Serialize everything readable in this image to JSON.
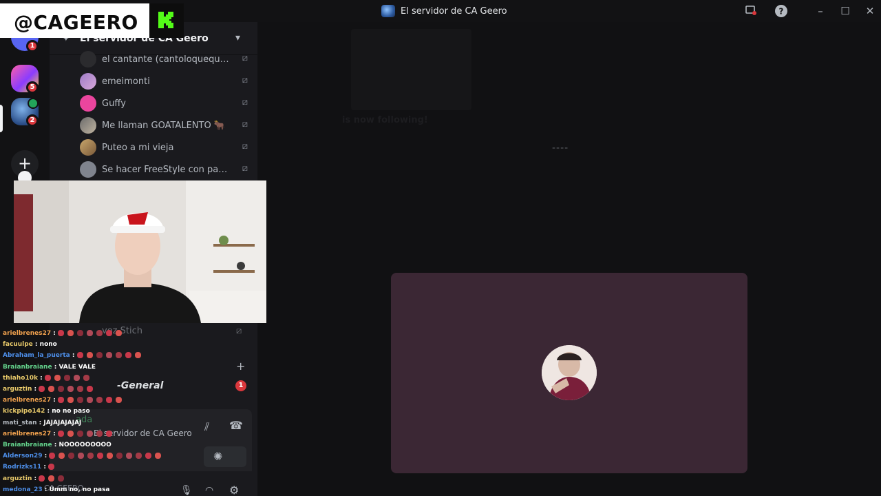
{
  "window": {
    "title": "El servidor de CA Geero"
  },
  "watermark": {
    "handle": "@CAGEERO"
  },
  "rail": {
    "badges": [
      "1",
      "5",
      "2"
    ],
    "add_label": "+"
  },
  "sidebar": {
    "server_name": "El servidor de CA Geero",
    "voice_users": [
      {
        "name": "el cantante (cantoloquequer..."
      },
      {
        "name": "emeimonti"
      },
      {
        "name": "Guffy"
      },
      {
        "name": "Me llaman GOATALENTO 🐂"
      },
      {
        "name": "Puteo a mi vieja"
      },
      {
        "name": "Se hacer FreeStyle con pala..."
      }
    ],
    "ghost_user": "voz Stich",
    "channel": "-General",
    "unread_count": "1",
    "voice_status": "ada",
    "voice_server": "El servidor de CA Geero",
    "account_name": "CA GEERO"
  },
  "chat": [
    {
      "user": "arielbrenes27",
      "color": "#f0a14e",
      "text": "",
      "emotes": 7
    },
    {
      "user": "facuulpe",
      "color": "#e8c96a",
      "text": "nono",
      "emotes": 0
    },
    {
      "user": "Abraham_la_puerta",
      "color": "#4d8ee8",
      "text": "",
      "emotes": 7
    },
    {
      "user": "Braianbraiane",
      "color": "#63d18b",
      "text": "VALE VALE",
      "emotes": 0
    },
    {
      "user": "thiaho10k",
      "color": "#e8c96a",
      "text": "",
      "emotes": 5
    },
    {
      "user": "arguztin",
      "color": "#e8c96a",
      "text": "",
      "emotes": 6
    },
    {
      "user": "arielbrenes27",
      "color": "#f0a14e",
      "text": "",
      "emotes": 7
    },
    {
      "user": "kickpipo142",
      "color": "#e8c96a",
      "text": "no no paso",
      "emotes": 0
    },
    {
      "user": "mati_stan",
      "color": "#b5bac1",
      "text": "JAJAJAJAJAJ",
      "emotes": 0
    },
    {
      "user": "arielbrenes27",
      "color": "#f0a14e",
      "text": "",
      "emotes": 6
    },
    {
      "user": "Braianbraiane",
      "color": "#63d18b",
      "text": "NOOOOOOOOO",
      "emotes": 0
    },
    {
      "user": "Alderson29",
      "color": "#4d8ee8",
      "text": "",
      "emotes": 12
    },
    {
      "user": "Rodrizks11",
      "color": "#4d8ee8",
      "text": "",
      "emotes": 1
    },
    {
      "user": "arguztin",
      "color": "#e8c96a",
      "text": "",
      "emotes": 3
    },
    {
      "user": "medona_23",
      "color": "#4d8ee8",
      "text": "Umm no, no pasa",
      "emotes": 0
    }
  ],
  "stage": {
    "ghost_text": "is now following!",
    "loader": "----"
  },
  "colors": {
    "accent_red": "#da373c",
    "tile_bg": "#3b2734",
    "kick_green": "#53fc18"
  }
}
